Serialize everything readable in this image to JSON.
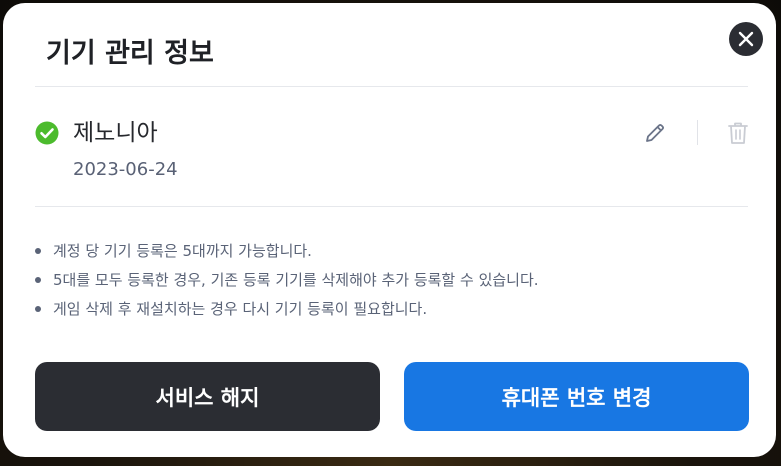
{
  "modal": {
    "title": "기기 관리 정보",
    "close_icon": "close-icon"
  },
  "device": {
    "status_icon": "check-circle-icon",
    "status_color": "#4cbb2d",
    "name": "제노니아",
    "registered_date": "2023-06-24",
    "edit_icon": "pencil-icon",
    "delete_icon": "trash-icon"
  },
  "notices": [
    "계정 당 기기 등록은 5대까지 가능합니다.",
    "5대를 모두 등록한 경우, 기존 등록 기기를 삭제해야 추가 등록할 수 있습니다.",
    "게임 삭제 후 재설치하는 경우 다시 기기 등록이 필요합니다."
  ],
  "buttons": {
    "cancel_service": "서비스 해지",
    "change_phone": "휴대폰 번호 변경"
  },
  "colors": {
    "primary": "#1877e3",
    "dark": "#2b2d33"
  }
}
